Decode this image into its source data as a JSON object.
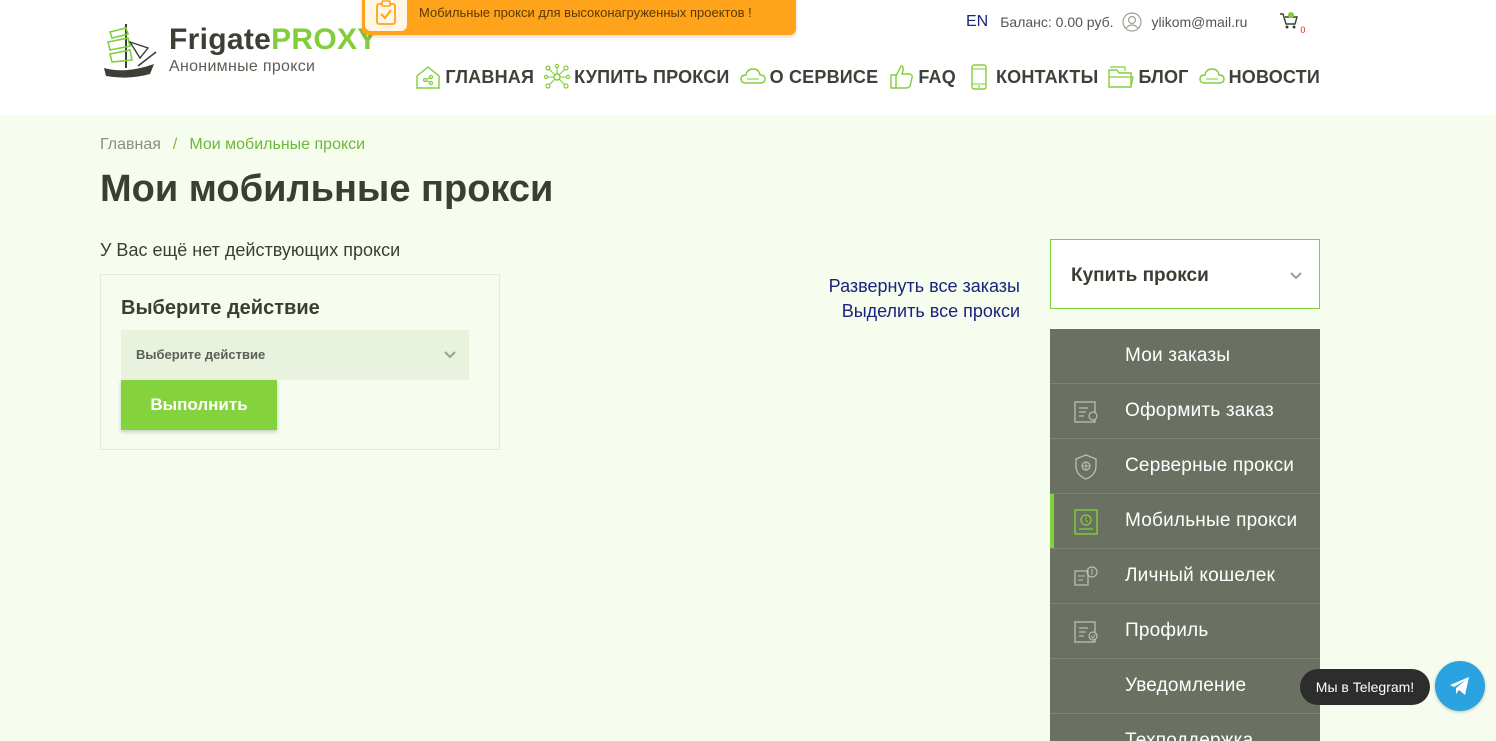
{
  "brand": {
    "name_part1": "Frigate",
    "name_part2": "PROXY",
    "tagline": "Анонимные прокси",
    "accent_color": "#80cf3a"
  },
  "promo": {
    "text": "Мобильные прокси для высоконагруженных проектов !",
    "icon": "clipboard-check-icon",
    "color": "#ffa31a"
  },
  "topbar": {
    "language": "EN",
    "balance": "Баланс: 0.00 руб.",
    "email": "ylikom@mail.ru",
    "cart_count": "0"
  },
  "nav": {
    "items": [
      {
        "label": "ГЛАВНАЯ",
        "icon": "home-share-icon"
      },
      {
        "label": "КУПИТЬ ПРОКСИ",
        "icon": "network-icon"
      },
      {
        "label": "О СЕРВИСЕ",
        "icon": "cloud-icon"
      },
      {
        "label": "FAQ",
        "icon": "thumbs-up-icon"
      },
      {
        "label": "КОНТАКТЫ",
        "icon": "phone-icon"
      },
      {
        "label": "БЛОГ",
        "icon": "folder-icon"
      },
      {
        "label": "НОВОСТИ",
        "icon": "cloud-icon"
      }
    ]
  },
  "breadcrumb": {
    "home": "Главная",
    "separator": "/",
    "current": "Мои мобильные прокси"
  },
  "page": {
    "title": "Мои мобильные прокси",
    "empty_message": "У Вас ещё нет действующих прокси"
  },
  "action_panel": {
    "title": "Выберите действие",
    "select_value": "Выберите действие",
    "run_button": "Выполнить"
  },
  "links": {
    "expand_all": "Развернуть все заказы",
    "select_all": "Выделить все прокси"
  },
  "sidebar": {
    "buy_label": "Купить прокси",
    "items": [
      {
        "label": "Мои заказы",
        "icon": ""
      },
      {
        "label": "Оформить заказ",
        "icon": "order-form-icon"
      },
      {
        "label": "Серверные прокси",
        "icon": "shield-globe-icon"
      },
      {
        "label": "Мобильные прокси",
        "icon": "mobile-proxy-icon",
        "active": true
      },
      {
        "label": "Личный кошелек",
        "icon": "wallet-icon"
      },
      {
        "label": "Профиль",
        "icon": "profile-card-icon"
      },
      {
        "label": "Уведомление",
        "icon": ""
      },
      {
        "label": "Техподдержка",
        "icon": ""
      }
    ]
  },
  "telegram": {
    "bubble_text": "Мы в Telegram!",
    "color": "#2aa3e0"
  }
}
